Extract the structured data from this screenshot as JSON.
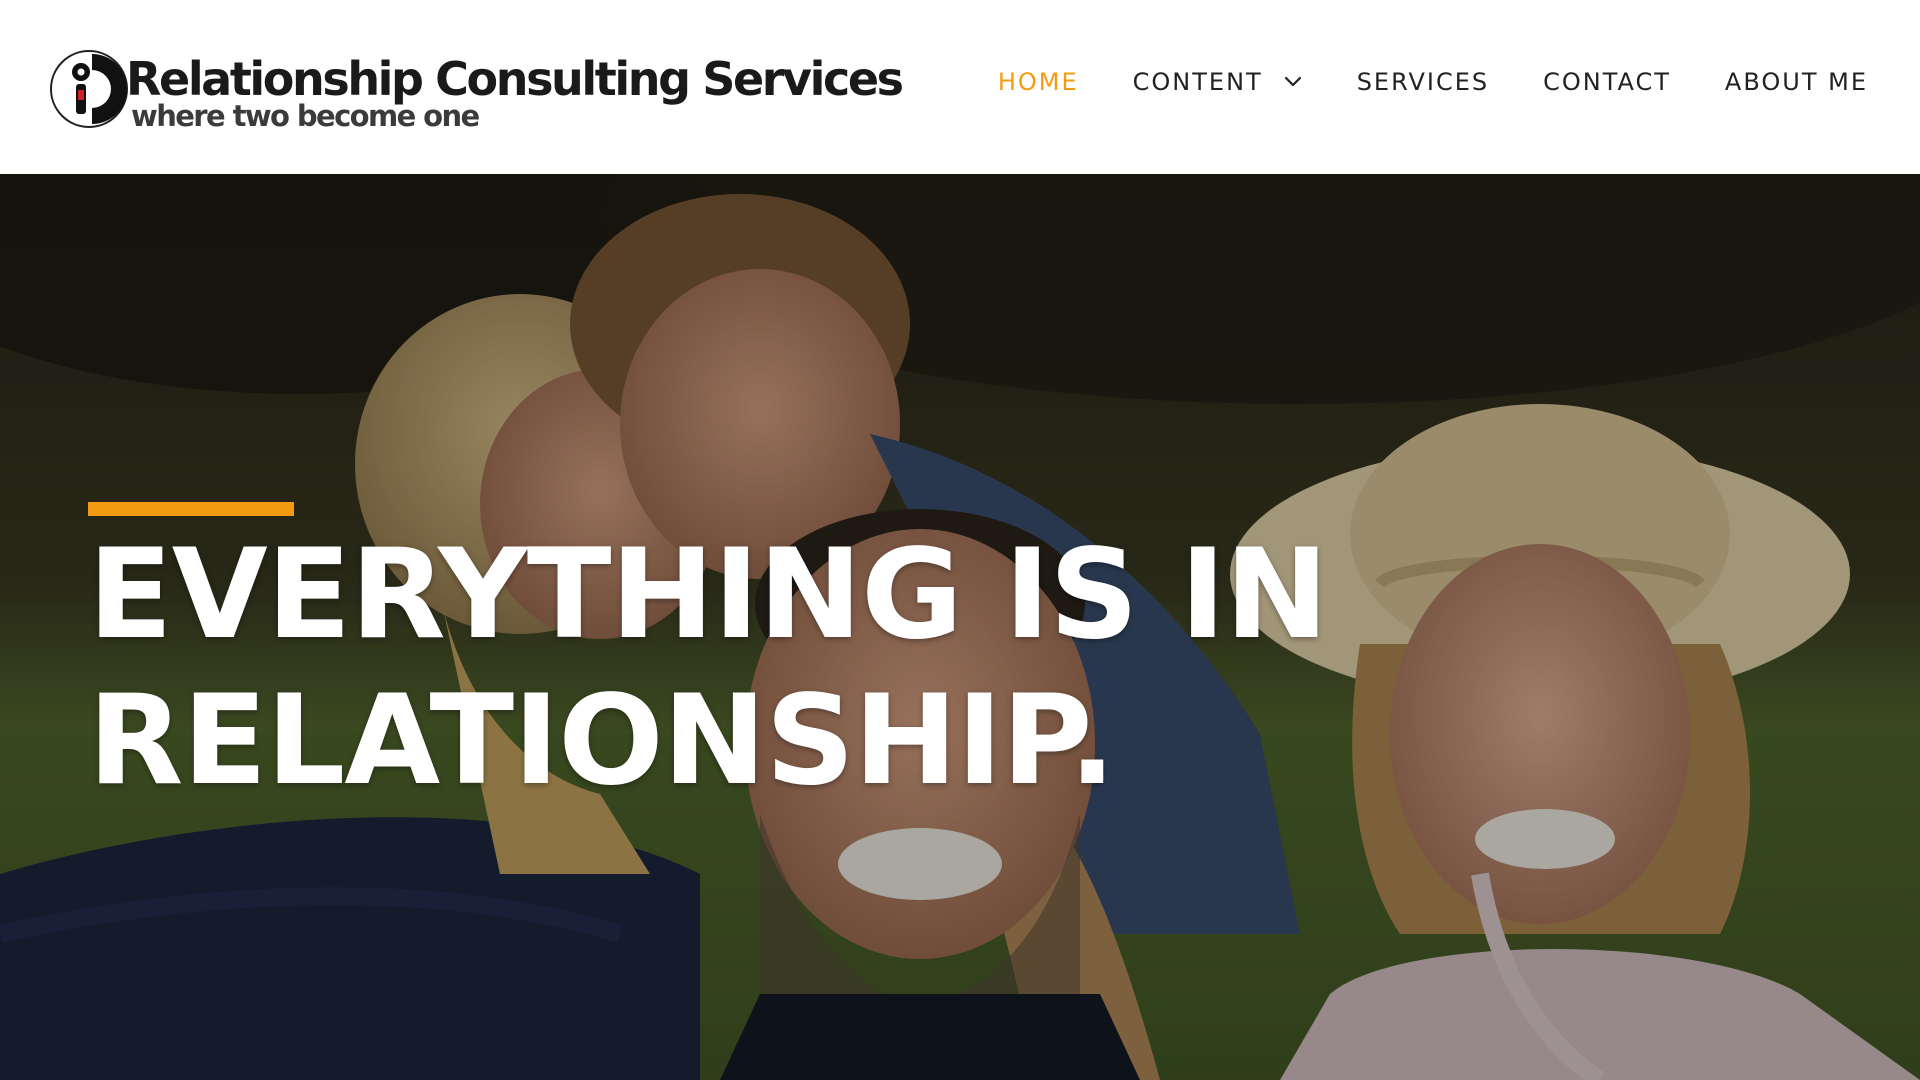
{
  "brand": {
    "title": "Relationship Consulting Services",
    "tagline": "where two become one",
    "logo_icon": "person-in-circle-logo",
    "logo_colors": {
      "dark": "#111111",
      "red": "#d0202a"
    }
  },
  "nav": {
    "items": [
      {
        "label": "HOME",
        "active": true
      },
      {
        "label": "CONTENT",
        "has_dropdown": true,
        "dropdown_icon": "chevron-down-icon"
      },
      {
        "label": "SERVICES"
      },
      {
        "label": "CONTACT"
      },
      {
        "label": "ABOUT ME"
      }
    ]
  },
  "hero": {
    "title_line1": "EVERYTHING IS IN",
    "title_line2": "RELATIONSHIP.",
    "image": "smiling-family-selfie-outdoors-photo"
  },
  "colors": {
    "accent": "#f39c12",
    "nav_text": "#222222",
    "hero_text": "#ffffff"
  }
}
